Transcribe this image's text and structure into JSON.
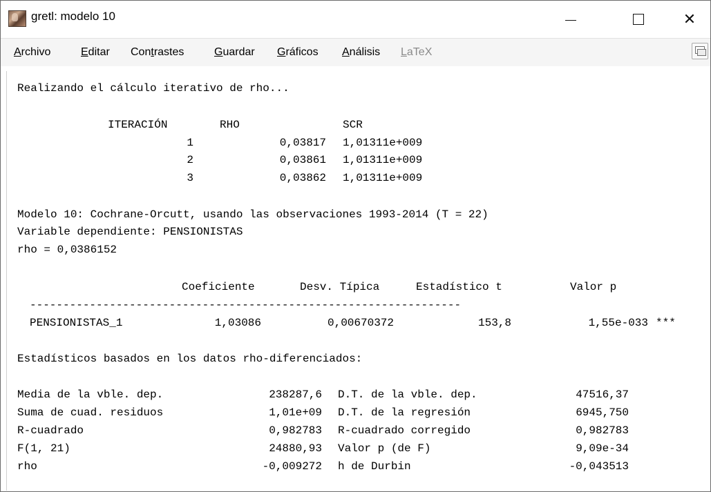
{
  "window": {
    "title": "gretl: modelo 10",
    "controls": {
      "minimize": "—",
      "maximize": "☐",
      "close": "✕"
    }
  },
  "menubar": {
    "items": [
      {
        "label": "Archivo",
        "mnemonic": "A",
        "rest": "rchivo",
        "enabled": true
      },
      {
        "label": "Editar",
        "mnemonic": "E",
        "rest": "ditar",
        "enabled": true
      },
      {
        "label": "Contrastes",
        "pre": "Con",
        "mnemonic": "t",
        "rest": "rastes",
        "enabled": true
      },
      {
        "label": "Guardar",
        "mnemonic": "G",
        "rest": "uardar",
        "enabled": true
      },
      {
        "label": "Gráficos",
        "mnemonic": "G",
        "rest": "ráficos",
        "enabled": true
      },
      {
        "label": "Análisis",
        "mnemonic": "A",
        "rest": "nálisis",
        "enabled": true
      },
      {
        "label": "LaTeX",
        "mnemonic": "L",
        "rest": "aTeX",
        "enabled": false
      }
    ]
  },
  "output": {
    "header": "Realizando el cálculo iterativo de rho...",
    "iter_table": {
      "columns": [
        "ITERACIÓN",
        "RHO",
        "SCR"
      ],
      "rows": [
        {
          "iter": "1",
          "rho": "0,03817",
          "scr": "1,01311e+009"
        },
        {
          "iter": "2",
          "rho": "0,03861",
          "scr": "1,01311e+009"
        },
        {
          "iter": "3",
          "rho": "0,03862",
          "scr": "1,01311e+009"
        }
      ]
    },
    "model_line": "Modelo 10: Cochrane-Orcutt, usando las observaciones 1993-2014 (T = 22)",
    "dep_var_line": "Variable dependiente: PENSIONISTAS",
    "rho_line": "rho = 0,0386152",
    "coef_table": {
      "columns": [
        "Coeficiente",
        "Desv. Típica",
        "Estadístico t",
        "Valor p"
      ],
      "separator": "-----------------------------------------------------------------",
      "rows": [
        {
          "name": "PENSIONISTAS_1",
          "coef": "1,03086",
          "se": "0,00670372",
          "t": "153,8",
          "p": "1,55e-033",
          "stars": "***"
        }
      ]
    },
    "stats_header": "Estadísticos basados en los datos rho-diferenciados:",
    "stats": [
      {
        "l_label": "Media de la vble. dep.",
        "l_value": "238287,6",
        "r_label": "D.T. de la vble. dep.",
        "r_value": "47516,37"
      },
      {
        "l_label": "Suma de cuad. residuos",
        "l_value": "1,01e+09",
        "r_label": "D.T. de la regresión",
        "r_value": "6945,750"
      },
      {
        "l_label": "R-cuadrado",
        "l_value": "0,982783",
        "r_label": "R-cuadrado corregido",
        "r_value": "0,982783"
      },
      {
        "l_label": "F(1, 21)",
        "l_value": "24880,93",
        "r_label": "Valor p (de F)",
        "r_value": "9,09e-34"
      },
      {
        "l_label": "rho",
        "l_value": "-0,009272",
        "r_label": "h de Durbin",
        "r_value": "-0,043513"
      }
    ]
  }
}
